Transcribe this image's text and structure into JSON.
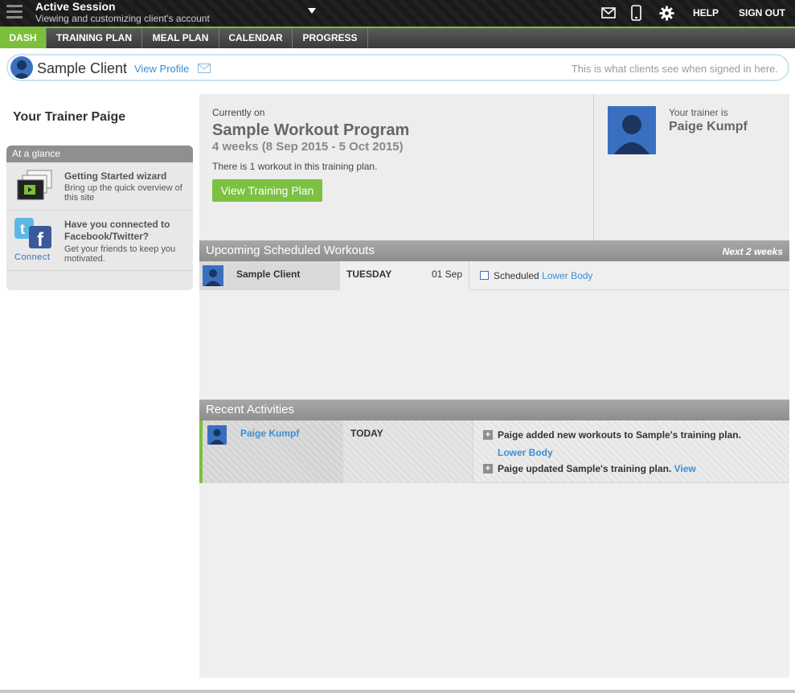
{
  "session": {
    "title": "Active Session",
    "subtitle": "Viewing and customizing client's account"
  },
  "topnav": {
    "help": "HELP",
    "signout": "SIGN OUT"
  },
  "tabs": [
    {
      "label": "DASH",
      "active": true
    },
    {
      "label": "TRAINING PLAN",
      "active": false
    },
    {
      "label": "MEAL PLAN",
      "active": false
    },
    {
      "label": "CALENDAR",
      "active": false
    },
    {
      "label": "PROGRESS",
      "active": false
    }
  ],
  "client": {
    "name": "Sample Client",
    "view_profile": "View Profile",
    "note": "This is what clients see when signed in here."
  },
  "sidebar": {
    "heading": "Your Trainer Paige",
    "glance_title": "At a glance",
    "items": [
      {
        "title": "Getting Started wizard",
        "desc": "Bring up the quick overview of this site"
      },
      {
        "title": "Have you connected to Facebook/Twitter?",
        "desc": "Get your friends to keep you motivated.",
        "action": "Connect"
      }
    ]
  },
  "program": {
    "currently_label": "Currently on",
    "title": "Sample Workout Program",
    "dates": "4 weeks (8 Sep 2015 - 5 Oct 2015)",
    "count_text": "There is 1 workout in this training plan.",
    "button": "View Training Plan"
  },
  "trainer": {
    "label": "Your trainer is",
    "name": "Paige Kumpf"
  },
  "upcoming": {
    "title": "Upcoming Scheduled Workouts",
    "range": "Next 2 weeks",
    "rows": [
      {
        "client": "Sample Client",
        "day": "TUESDAY",
        "date": "01 Sep",
        "status": "Scheduled",
        "workout": "Lower Body"
      }
    ]
  },
  "activities": {
    "title": "Recent Activities",
    "rows": [
      {
        "person": "Paige Kumpf",
        "when": "TODAY",
        "line1": "Paige added new workouts to Sample's training plan.",
        "line1_link": "Lower Body",
        "line2": "Paige updated Sample's training plan.",
        "line2_link": "View"
      }
    ]
  },
  "colors": {
    "accent": "#7cbf3a",
    "link": "#3a8fd8",
    "topbar": "#1a1a1a"
  }
}
